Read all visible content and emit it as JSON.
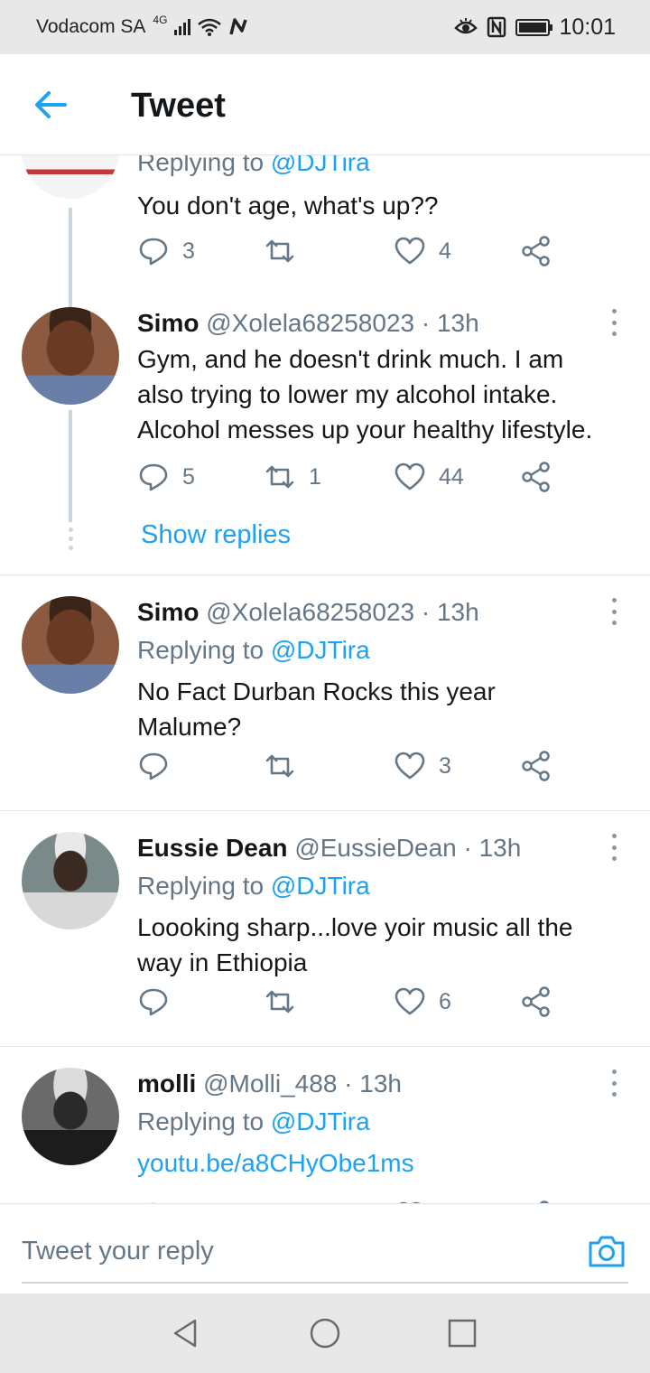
{
  "status_bar": {
    "carrier": "Vodacom SA",
    "network": "4G",
    "time": "10:01"
  },
  "header": {
    "title": "Tweet"
  },
  "tweets": [
    {
      "reply_to_label": "Replying to",
      "reply_to_handle": "@DJTira",
      "text": "You don't age, what's up??",
      "replies": "3",
      "retweets": "",
      "likes": "4"
    },
    {
      "name": "Simo",
      "handle_time": "@Xolela68258023 · 13h",
      "text_lines": [
        "Gym, and he doesn't drink much. I am",
        "also trying to lower my alcohol intake.",
        "Alcohol messes up your healthy lifestyle."
      ],
      "replies": "5",
      "retweets": "1",
      "likes": "44",
      "show_replies": "Show replies"
    },
    {
      "name": "Simo",
      "handle_time": "@Xolela68258023 · 13h",
      "reply_to_label": "Replying to",
      "reply_to_handle": "@DJTira",
      "text_lines": [
        "No Fact Durban Rocks this year",
        "Malume?"
      ],
      "replies": "",
      "retweets": "",
      "likes": "3"
    },
    {
      "name": "Eussie Dean",
      "handle_time": "@EussieDean · 13h",
      "reply_to_label": "Replying to",
      "reply_to_handle": "@DJTira",
      "text_lines": [
        "Loooking sharp...love yoir music all the",
        "way in Ethiopia"
      ],
      "replies": "",
      "retweets": "",
      "likes": "6"
    },
    {
      "name": "molli",
      "handle_time": "@Molli_488 · 13h",
      "reply_to_label": "Replying to",
      "reply_to_handle": "@DJTira",
      "link": "youtu.be/a8CHyObe1ms"
    }
  ],
  "composer": {
    "placeholder": "Tweet your reply"
  },
  "colors": {
    "accent": "#1da1f2",
    "secondary_text": "#657786",
    "primary_text": "#14171a",
    "system_bar": "#e8e8e8"
  },
  "icons": [
    "back-arrow-icon",
    "reply-icon",
    "retweet-icon",
    "like-icon",
    "share-icon",
    "more-vertical-icon",
    "camera-icon",
    "nav-back-icon",
    "nav-home-icon",
    "nav-recents-icon"
  ]
}
